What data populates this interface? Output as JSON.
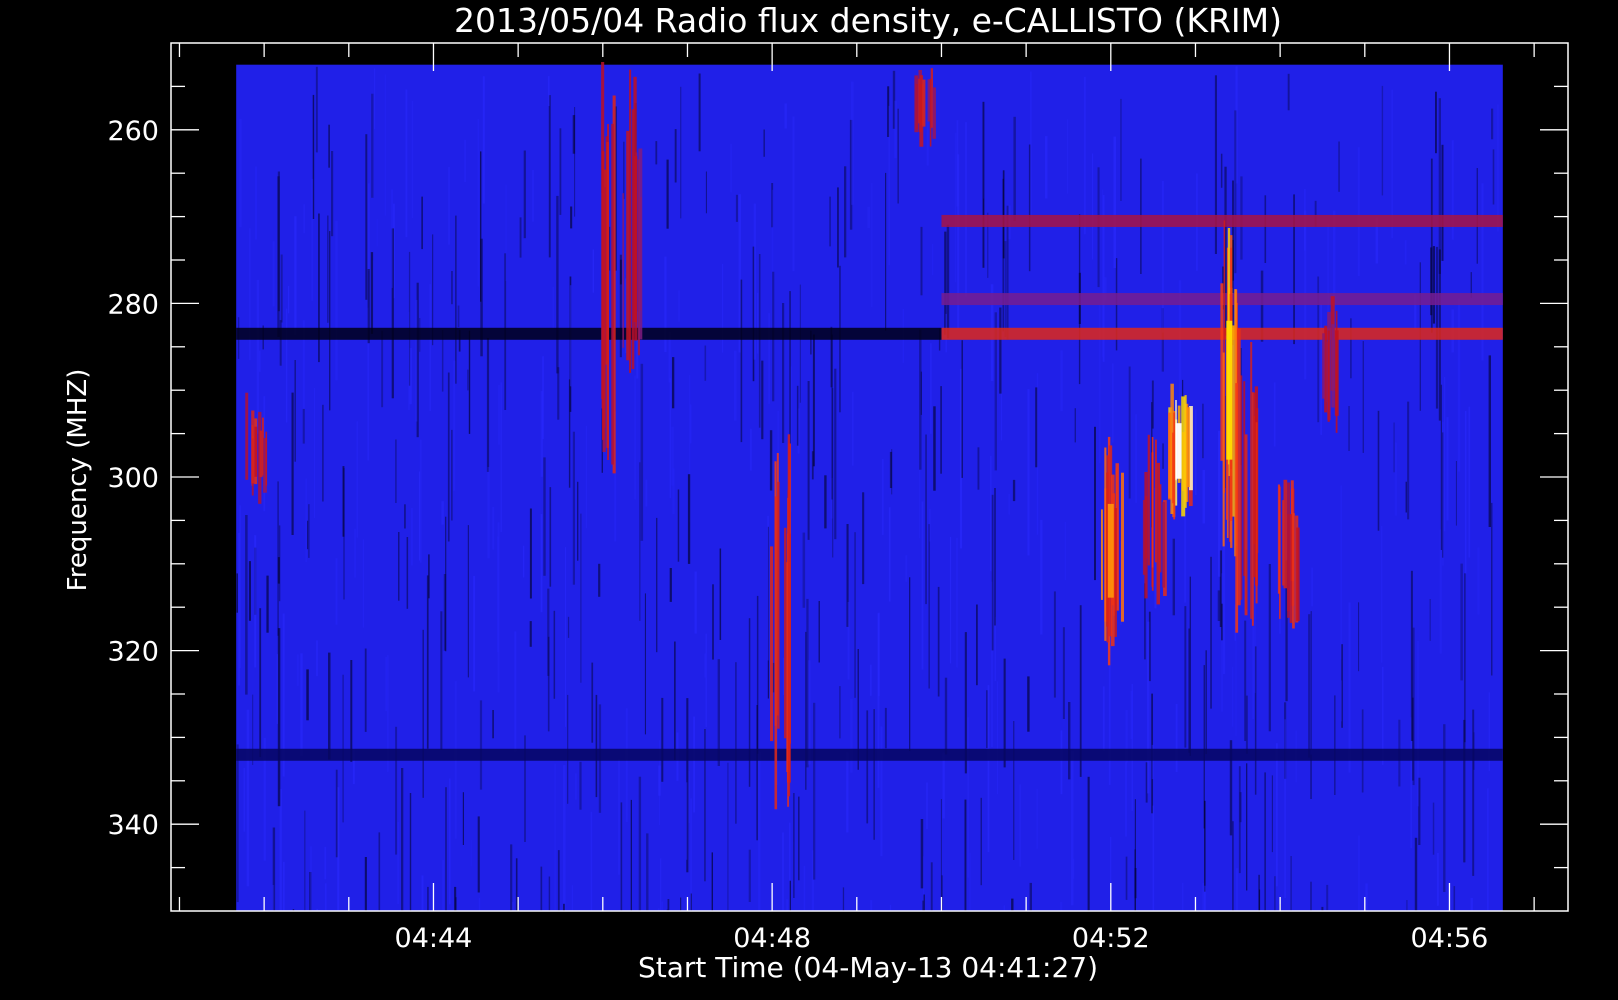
{
  "chart_data": {
    "type": "heatmap",
    "title": "2013/05/04  Radio flux density, e-CALLISTO (KRIM)",
    "xlabel": "Start Time (04-May-13 04:41:27)",
    "ylabel": "Frequency (MHZ)",
    "x_ticks": [
      "04:44",
      "04:48",
      "04:52",
      "04:56"
    ],
    "x_tick_minutes": [
      164,
      168,
      172,
      176
    ],
    "y_ticks": [
      260,
      280,
      300,
      320,
      340
    ],
    "xlim_minutes": [
      160.9,
      177.4
    ],
    "ylim_mhz": [
      250,
      350
    ],
    "data_xlim_minutes": [
      161.67,
      176.63
    ],
    "data_ylim_mhz": [
      252.5,
      350
    ],
    "y_reversed": true,
    "colormap": [
      "#00001a",
      "#1010c8",
      "#2a2aff",
      "#c01020",
      "#ff4010",
      "#ffe000",
      "#ffffff"
    ],
    "background_color": "#2020e8",
    "bursts": [
      {
        "t": 172.0,
        "f0": 295,
        "f1": 322,
        "level": 0.75
      },
      {
        "t": 172.5,
        "f0": 295,
        "f1": 315,
        "level": 0.55
      },
      {
        "t": 172.8,
        "f0": 289,
        "f1": 305,
        "level": 1.0
      },
      {
        "t": 173.4,
        "f0": 270,
        "f1": 310,
        "level": 0.9
      },
      {
        "t": 173.6,
        "f0": 282,
        "f1": 318,
        "level": 0.6
      },
      {
        "t": 174.1,
        "f0": 298,
        "f1": 318,
        "level": 0.55
      },
      {
        "t": 168.1,
        "f0": 294,
        "f1": 340,
        "level": 0.6
      },
      {
        "t": 166.0,
        "f0": 252,
        "f1": 300,
        "level": 0.45
      },
      {
        "t": 166.3,
        "f0": 252,
        "f1": 292,
        "level": 0.4
      },
      {
        "t": 161.9,
        "f0": 290,
        "f1": 304,
        "level": 0.55
      },
      {
        "t": 169.8,
        "f0": 252,
        "f1": 262,
        "level": 0.5
      },
      {
        "t": 174.6,
        "f0": 278,
        "f1": 295,
        "level": 0.35
      }
    ],
    "bands": [
      {
        "f": 283.5,
        "t0": 170.0,
        "t1": 176.63,
        "level": 0.45
      },
      {
        "f": 283.5,
        "t0": 161.67,
        "t1": 170.0,
        "level": -1
      },
      {
        "f": 270.5,
        "t0": 170.0,
        "t1": 176.63,
        "level": 0.25
      },
      {
        "f": 279.5,
        "t0": 170.0,
        "t1": 176.63,
        "level": 0.15
      },
      {
        "f": 332.0,
        "t0": 161.67,
        "t1": 176.63,
        "level": -0.6
      }
    ]
  }
}
